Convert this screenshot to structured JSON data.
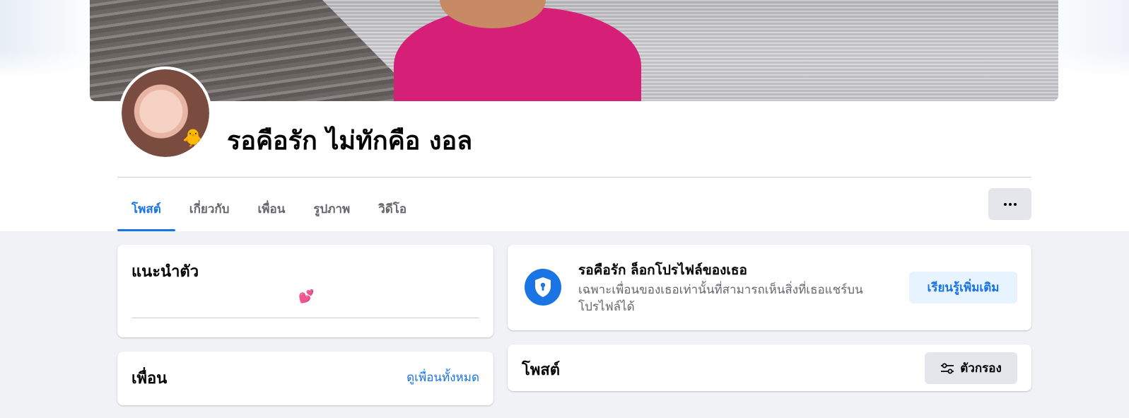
{
  "profile": {
    "name": "รอคือรัก ไม่ทักคือ งอล"
  },
  "tabs": [
    {
      "label": "โพสต์",
      "active": true
    },
    {
      "label": "เกี่ยวกับ",
      "active": false
    },
    {
      "label": "เพื่อน",
      "active": false
    },
    {
      "label": "รูปภาพ",
      "active": false
    },
    {
      "label": "วิดีโอ",
      "active": false
    }
  ],
  "more_icon": "ellipsis-icon",
  "intro": {
    "title": "แนะนำตัว",
    "bio": "💕"
  },
  "friends": {
    "title": "เพื่อน",
    "see_all": "ดูเพื่อนทั้งหมด"
  },
  "locked_notice": {
    "title": "รอคือรัก ล็อกโปรไฟล์ของเธอ",
    "description": "เฉพาะเพื่อนของเธอเท่านั้นที่สามารถเห็นสิ่งที่เธอแชร์บนโปรไฟล์ได้",
    "learn_more": "เรียนรู้เพิ่มเติม",
    "icon": "shield-keyhole-icon"
  },
  "posts": {
    "title": "โพสต์",
    "filter_label": "ตัวกรอง",
    "filter_icon": "sliders-icon"
  },
  "colors": {
    "accent": "#1b74e4",
    "page_bg": "#f0f2f5",
    "button_bg": "#e4e6eb",
    "light_accent_bg": "#e7f3ff"
  }
}
